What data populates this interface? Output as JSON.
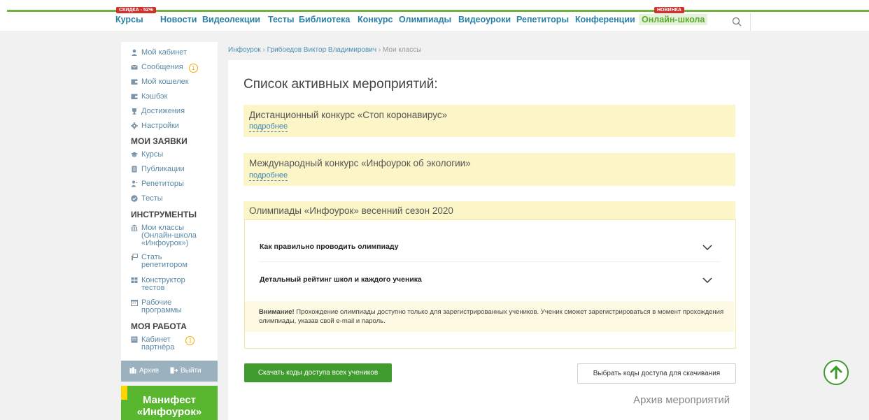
{
  "nav": {
    "badges": {
      "courses": "скидка - 52%",
      "school": "новинка"
    },
    "items": [
      "Курсы",
      "Новости",
      "Видеолекции",
      "Тесты",
      "Библиотека",
      "Конкурс",
      "Олимпиады",
      "Видеоуроки",
      "Репетиторы",
      "Конференции",
      "Онлайн-школа"
    ]
  },
  "sidebar": {
    "items": [
      {
        "label": "Мой кабинет",
        "icon": "user-icon"
      },
      {
        "label": "Сообщения",
        "icon": "envelope-icon",
        "badge": "1"
      },
      {
        "label": "Мой кошелек",
        "icon": "wallet-icon"
      },
      {
        "label": "Кэшбэк",
        "icon": "wallet-icon"
      },
      {
        "label": "Достижения",
        "icon": "trophy-icon"
      },
      {
        "label": "Настройки",
        "icon": "gear-icon"
      }
    ],
    "section_requests": "МОИ ЗАЯВКИ",
    "requests": [
      {
        "label": "Курсы",
        "icon": "graduation-cap-icon"
      },
      {
        "label": "Публикации",
        "icon": "document-icon"
      },
      {
        "label": "Репетиторы",
        "icon": "tutor-icon"
      },
      {
        "label": "Тесты",
        "icon": "check-circle-icon"
      }
    ],
    "section_tools": "ИНСТРУМЕНТЫ",
    "tools": [
      {
        "line1": "Мои классы",
        "line2": "(Онлайн-школа",
        "line3": "«Инфоурок»)",
        "icon": "classroom-icon"
      },
      {
        "line1": "Стать",
        "line2": "репетитором",
        "icon": "board-icon"
      },
      {
        "line1": "Конструктор",
        "line2": "тестов",
        "icon": "grid-icon"
      },
      {
        "line1": "Рабочие",
        "line2": "программы",
        "icon": "calendar-icon"
      }
    ],
    "section_work": "МОЯ РАБОТА",
    "work": [
      {
        "line1": "Кабинет",
        "line2": "партнёра",
        "icon": "partner-icon",
        "badge": "1"
      }
    ],
    "footer": {
      "archive": "Архив",
      "logout": "Выйти"
    },
    "manifest": {
      "line1": "Манифест",
      "line2": "«Инфоурок»"
    }
  },
  "breadcrumb": {
    "home": "Инфоурок",
    "sep": " › ",
    "person": "Грибоедов Виктор Владимирович",
    "current": "Мои классы"
  },
  "main": {
    "title": "Список активных мероприятий:",
    "events": [
      {
        "name": "Дистанционный конкурс «Стоп коронавирус»",
        "more": "подробнее"
      },
      {
        "name": "Международный конкурс «Инфоурок об экологии»",
        "more": "подробнее"
      },
      {
        "name": "Олимпиады «Инфоурок» весенний сезон 2020"
      }
    ],
    "accordion": [
      "Как правильно проводить олимпиаду",
      "Детальный рейтинг школ и каждого ученика"
    ],
    "warning_bold": "Внимание!",
    "warning_text": " Прохождение олимпиады доступно только для зарегистрированных учеников. Ученик сможет зарегистрироваться в момент прохождения олимпиады, указав свой e-mail и пароль.",
    "download_all": "Скачать коды доступа всех учеников",
    "choose_codes": "Выбрать коды доступа для скачивания",
    "archive_link": "Архив мероприятий"
  },
  "colors": {
    "accent_green": "#6fb43f",
    "link_blue": "#2a7fa6",
    "event_yellow": "#fcf5c7",
    "button_green": "#3f9b2d"
  }
}
